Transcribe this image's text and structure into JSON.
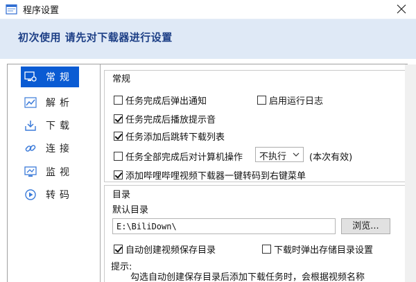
{
  "window": {
    "title": "程序设置",
    "icon": "window-app-icon"
  },
  "banner": {
    "text": "初次使用  请先对下载器进行设置"
  },
  "nav": [
    {
      "label": "常规",
      "icon": "monitor-settings-icon",
      "active": true
    },
    {
      "label": "解析",
      "icon": "line-chart-icon",
      "active": false
    },
    {
      "label": "下载",
      "icon": "download-tray-icon",
      "active": false
    },
    {
      "label": "连接",
      "icon": "link-chain-icon",
      "active": false
    },
    {
      "label": "监视",
      "icon": "screen-monitor-icon",
      "active": false
    },
    {
      "label": "转码",
      "icon": "convert-play-icon",
      "active": false
    }
  ],
  "general": {
    "title": "常规",
    "notify_on_done": {
      "label": "任务完成后弹出通知",
      "checked": false
    },
    "enable_log": {
      "label": "启用运行日志",
      "checked": false
    },
    "play_sound": {
      "label": "任务完成后播放提示音",
      "checked": true
    },
    "jump_to_list": {
      "label": "任务添加后跳转下载列表",
      "checked": true
    },
    "computer_action": {
      "label": "任务全部完成后对计算机操作",
      "checked": false,
      "select_value": "不执行",
      "note": "(本次有效)"
    },
    "context_menu": {
      "label": "添加哔哩哔哩视频下载器一键转码到右键菜单",
      "checked": true
    }
  },
  "directory": {
    "title": "目录",
    "default_label": "默认目录",
    "path": "E:\\BiliDown\\",
    "browse": "浏览...",
    "auto_create": {
      "label": "自动创建视频保存目录",
      "checked": true
    },
    "ask_on_download": {
      "label": "下载时弹出存储目录设置",
      "checked": false
    },
    "hint_label": "提示:",
    "hint_text": "勾选自动创建保存目录后添加下载任务时，会根据视频名称"
  }
}
